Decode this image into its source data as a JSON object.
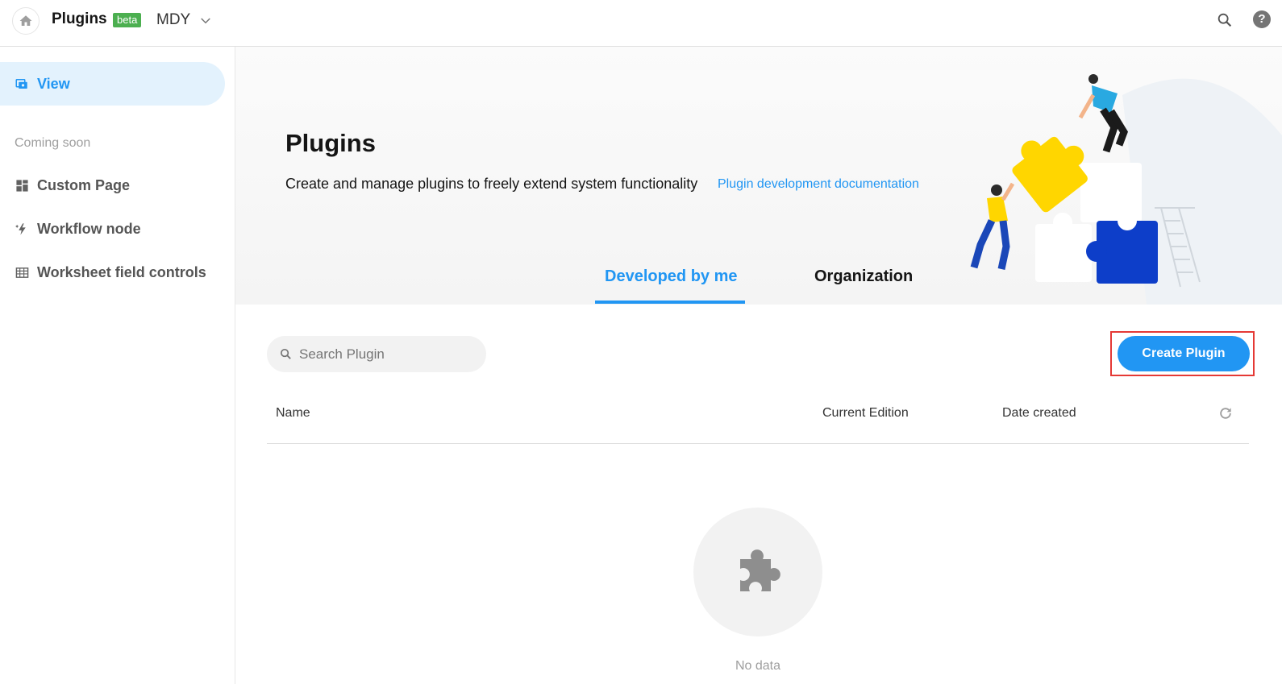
{
  "header": {
    "app_title": "Plugins",
    "badge": "beta",
    "org_name": "MDY",
    "icons": [
      "home-icon",
      "chevron-down-icon",
      "search-icon",
      "help-icon"
    ]
  },
  "sidebar": {
    "active_item": {
      "label": "View",
      "icon": "view-icon"
    },
    "section_label": "Coming soon",
    "items": [
      {
        "label": "Custom Page",
        "icon": "dashboard-icon"
      },
      {
        "label": "Workflow node",
        "icon": "magic-icon"
      },
      {
        "label": "Worksheet field controls",
        "icon": "table-icon"
      }
    ]
  },
  "banner": {
    "title": "Plugins",
    "description": "Create and manage plugins to freely extend system functionality",
    "doc_link": "Plugin development documentation",
    "tabs": [
      {
        "label": "Developed by me",
        "active": true
      },
      {
        "label": "Organization",
        "active": false
      }
    ]
  },
  "toolbar": {
    "search_placeholder": "Search Plugin",
    "create_button": "Create Plugin"
  },
  "table": {
    "columns": [
      "Name",
      "Current Edition",
      "Date created"
    ],
    "rows": []
  },
  "empty_state": {
    "text": "No data",
    "icon": "puzzle-icon"
  },
  "colors": {
    "accent": "#2196f3",
    "badge": "#4caf50",
    "highlight": "#e53935"
  }
}
